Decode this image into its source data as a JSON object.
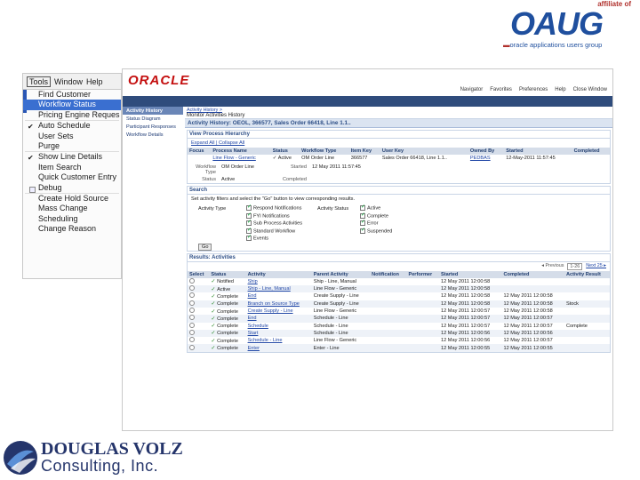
{
  "branding": {
    "oaug_affil": "affiliate of",
    "oaug_logo": "OAUG",
    "oaug_tag_prefix": "▬",
    "oaug_tag": "oracle applications users group",
    "dv_line1": "DOUGLAS VOLZ",
    "dv_line2": "Consulting, Inc."
  },
  "menu": {
    "bar": [
      "Tools",
      "Window",
      "Help"
    ],
    "items": [
      {
        "label": "Find Customer",
        "mark": ""
      },
      {
        "label": "Workflow Status",
        "mark": "",
        "highlight": true
      },
      {
        "label": "Pricing Engine Reques",
        "mark": ""
      },
      {
        "label": "Auto Schedule",
        "mark": "check"
      },
      {
        "label": "User Sets",
        "mark": ""
      },
      {
        "label": "Purge",
        "mark": ""
      },
      {
        "label": "Show Line Details",
        "mark": "check"
      },
      {
        "label": "Item Search",
        "mark": ""
      },
      {
        "label": "Quick Customer Entry",
        "mark": ""
      },
      {
        "label": "Debug",
        "mark": "box"
      },
      {
        "label": "Create Hold Source",
        "mark": ""
      },
      {
        "label": "Mass Change",
        "mark": ""
      },
      {
        "label": "Scheduling",
        "mark": ""
      },
      {
        "label": "Change Reason",
        "mark": ""
      }
    ]
  },
  "app": {
    "brand": "ORACLE",
    "global": [
      "Navigator",
      "Favorites",
      "Preferences",
      "Help",
      "Close Window"
    ],
    "sidenav": [
      "Activity History",
      "Status Diagram",
      "Participant Responses",
      "Workflow Details"
    ],
    "crumb": "Activity History >",
    "ptitle": "Monitor Activities History",
    "page_header": "Activity History: OEOL, 366577, Sales Order 66418, Line 1.1..",
    "hierarchy_label": "View Process Hierarchy",
    "hier_links": "Expand All | Collapse All",
    "hier_cols": [
      "Focus",
      "Process Name",
      "Status",
      "Workflow Type",
      "Item Key",
      "User Key",
      "Owned By",
      "Started",
      "Completed"
    ],
    "hier_row": [
      "",
      "Line Flow - Generic",
      "✓ Active",
      "OM Order Line",
      "366577",
      "Sales Order 66418, Line 1.1..",
      "PEDBAS",
      "12-May-2011 11:57:45",
      ""
    ],
    "kv_rows": [
      {
        "k1": "Workflow Type",
        "v1": "OM Order Line",
        "k2": "Started",
        "v2": "12 May 2011 11:57:45"
      },
      {
        "k1": "Status",
        "v1": "Active",
        "k2": "Completed",
        "v2": ""
      }
    ],
    "search_title": "Search",
    "search_hint": "Set activity filters and select the \"Go\" button to view corresponding results.",
    "activity_type_label": "Activity Type",
    "activity_status_label": "Activity Status",
    "types": [
      "Respond Notifications",
      "FYI Notifications",
      "Sub Process Activities",
      "Standard Workflow",
      "Events"
    ],
    "statuses": [
      "Active",
      "Complete",
      "Error",
      "Suspended"
    ],
    "go": "Go",
    "results_title": "Results: Activities",
    "pager": {
      "prev": "◂ Previous",
      "range": "1-26",
      "next": "Next 25 ▸"
    },
    "cols": [
      "Select",
      "Status",
      "Activity",
      "Parent Activity",
      "Notification",
      "Performer",
      "Started",
      "Completed",
      "Activity Result"
    ],
    "rows": [
      {
        "status": "Notified",
        "activity": "Ship",
        "parent": "Ship - Line, Manual",
        "started": "12 May 2011 12:00:58",
        "completed": "",
        "result": ""
      },
      {
        "status": "Active",
        "activity": "Ship - Line, Manual",
        "parent": "Line Flow - Generic",
        "started": "12 May 2011 12:00:58",
        "completed": "",
        "result": ""
      },
      {
        "status": "Complete",
        "activity": "End",
        "parent": "Create Supply - Line",
        "started": "12 May 2011 12:00:58",
        "completed": "12 May 2011 12:00:58",
        "result": ""
      },
      {
        "status": "Complete",
        "activity": "Branch on Source Type",
        "parent": "Create Supply - Line",
        "started": "12 May 2011 12:00:58",
        "completed": "12 May 2011 12:00:58",
        "result": "Stock"
      },
      {
        "status": "Complete",
        "activity": "Create Supply - Line",
        "parent": "Line Flow - Generic",
        "started": "12 May 2011 12:00:57",
        "completed": "12 May 2011 12:00:58",
        "result": ""
      },
      {
        "status": "Complete",
        "activity": "End",
        "parent": "Schedule - Line",
        "started": "12 May 2011 12:00:57",
        "completed": "12 May 2011 12:00:57",
        "result": ""
      },
      {
        "status": "Complete",
        "activity": "Schedule",
        "parent": "Schedule - Line",
        "started": "12 May 2011 12:00:57",
        "completed": "12 May 2011 12:00:57",
        "result": "Complete"
      },
      {
        "status": "Complete",
        "activity": "Start",
        "parent": "Schedule - Line",
        "started": "12 May 2011 12:00:56",
        "completed": "12 May 2011 12:00:56",
        "result": ""
      },
      {
        "status": "Complete",
        "activity": "Schedule - Line",
        "parent": "Line Flow - Generic",
        "started": "12 May 2011 12:00:56",
        "completed": "12 May 2011 12:00:57",
        "result": ""
      },
      {
        "status": "Complete",
        "activity": "Enter",
        "parent": "Enter - Line",
        "started": "12 May 2011 12:00:55",
        "completed": "12 May 2011 12:00:55",
        "result": ""
      }
    ]
  }
}
